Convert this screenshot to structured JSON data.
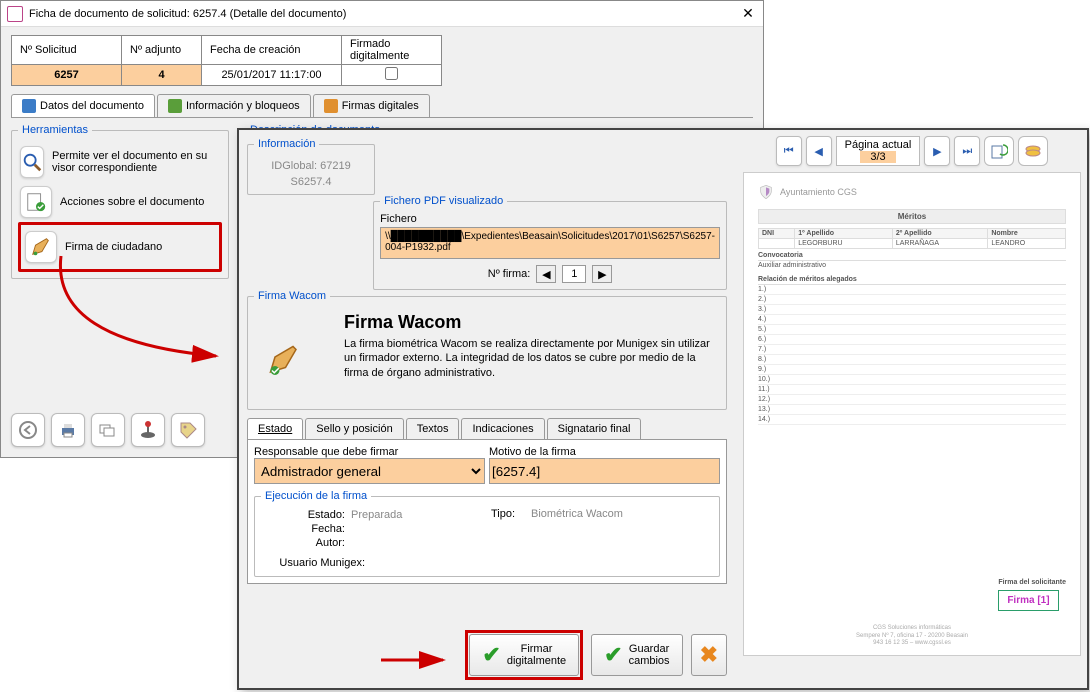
{
  "window1": {
    "title": "Ficha de documento de solicitud: 6257.4 (Detalle del documento)",
    "grid": {
      "h_num_sol": "Nº Solicitud",
      "h_num_adj": "Nº adjunto",
      "h_fecha": "Fecha de creación",
      "h_firmado": "Firmado digitalmente",
      "num_sol": "6257",
      "num_adj": "4",
      "fecha": "25/01/2017 11:17:00"
    },
    "tabs": {
      "datos": "Datos del documento",
      "info": "Información y bloqueos",
      "firmas": "Firmas digitales"
    },
    "herramientas": {
      "legend": "Herramientas",
      "visor": "Permite ver el documento en su visor correspondiente",
      "acciones": "Acciones sobre el documento",
      "firma": "Firma de ciudadano"
    },
    "desc_legend": "Descripción de documento"
  },
  "window2": {
    "info": {
      "legend": "Información",
      "idglobal": "IDGlobal: 67219",
      "s": "S6257.4"
    },
    "pdf": {
      "legend": "Fichero PDF visualizado",
      "fichero_label": "Fichero",
      "path": "\\\\██████████\\Expedientes\\Beasain\\Solicitudes\\2017\\01\\S6257\\S6257-004-P1932.pdf",
      "num_firma_label": "Nº firma:",
      "num_firma_val": "1"
    },
    "wacom": {
      "legend": "Firma Wacom",
      "title": "Firma Wacom",
      "desc": "La firma biométrica Wacom se realiza directamente por Munigex sin utilizar un firmador externo. La integridad de los datos se cubre por medio de la firma de órgano administrativo."
    },
    "tabs2": {
      "estado": "Estado",
      "sello": "Sello y posición",
      "textos": "Textos",
      "indic": "Indicaciones",
      "signat": "Signatario final"
    },
    "estado_panel": {
      "resp_label": "Responsable que debe firmar",
      "resp_value": "Admistrador general",
      "motivo_label": "Motivo de la firma",
      "motivo_value": "[6257.4]"
    },
    "exec": {
      "legend": "Ejecución de la firma",
      "estado_l": "Estado:",
      "estado_v": "Preparada",
      "fecha_l": "Fecha:",
      "autor_l": "Autor:",
      "usuario_l": "Usuario Munigex:",
      "tipo_l": "Tipo:",
      "tipo_v": "Biométrica Wacom"
    },
    "buttons": {
      "firmar": "Firmar digitalmente",
      "guardar": "Guardar cambios"
    }
  },
  "preview": {
    "page_label": "Página actual",
    "page_cur": "3/3",
    "org": "Ayuntamiento CGS",
    "meritos": "Méritos",
    "th_dni": "DNI",
    "th_ap1": "1º Apellido",
    "th_ap2": "2º Apellido",
    "th_nom": "Nombre",
    "row_ap1": "LEGORBURU",
    "row_ap2": "LARRAÑAGA",
    "row_nom": "LEANDRO",
    "convoc": "Convocatoria",
    "aux": "Auxiliar administrativo",
    "relacion": "Relación de méritos alegados",
    "firma_sol": "Firma del solicitante",
    "firma_mark": "Firma [1]",
    "foot1": "CGS Soluciones informáticas",
    "foot2": "Sempere Nº 7, oficina 17 - 20200 Beasain",
    "foot3": "943 16 12 35 – www.cgssl.es"
  },
  "chart_data": null
}
